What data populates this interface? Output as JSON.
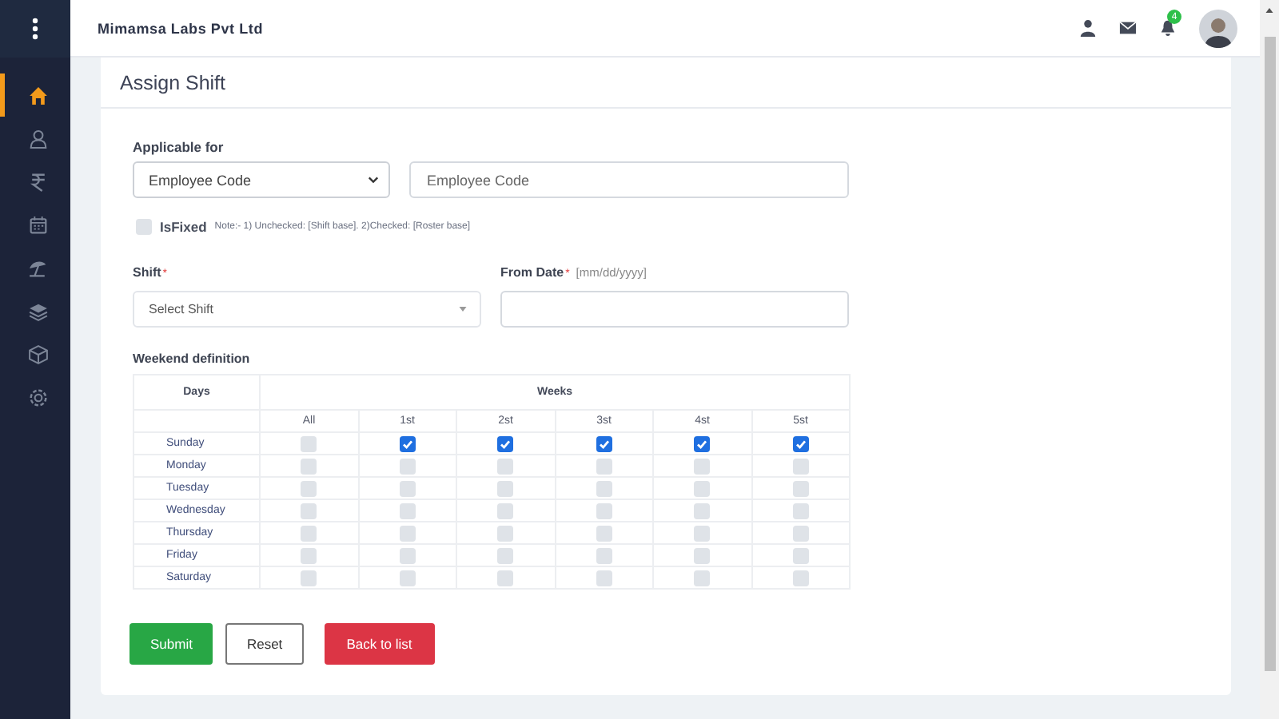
{
  "header": {
    "company": "Mimamsa Labs Pvt Ltd",
    "notification_count": "4"
  },
  "sidebar": {
    "items": [
      {
        "kind": "home",
        "selected": true
      },
      {
        "kind": "users",
        "selected": false
      },
      {
        "kind": "rupee",
        "selected": false
      },
      {
        "kind": "calendar",
        "selected": false
      },
      {
        "kind": "umbrella",
        "selected": false
      },
      {
        "kind": "layers",
        "selected": false
      },
      {
        "kind": "box",
        "selected": false
      },
      {
        "kind": "gear",
        "selected": false
      }
    ]
  },
  "page_title": "Assign Shift",
  "applicable_for": {
    "label": "Applicable for",
    "select_value": "Employee Code",
    "input_placeholder": "Employee Code"
  },
  "is_fixed": {
    "label": "IsFixed",
    "checked": false,
    "note": "Note:- 1) Unchecked: [Shift base]. 2)Checked: [Roster base]"
  },
  "shift": {
    "label": "Shift",
    "required_mark": "*",
    "placeholder": "Select Shift"
  },
  "from_date": {
    "label": "From Date",
    "required_mark": "*",
    "hint": "[mm/dd/yyyy]"
  },
  "weekend": {
    "title": "Weekend definition",
    "days_heading": "Days",
    "weeks_heading": "Weeks",
    "columns": [
      "All",
      "1st",
      "2st",
      "3st",
      "4st",
      "5st"
    ],
    "rows": [
      {
        "day": "Sunday",
        "checks": [
          false,
          true,
          true,
          true,
          true,
          true
        ]
      },
      {
        "day": "Monday",
        "checks": [
          false,
          false,
          false,
          false,
          false,
          false
        ]
      },
      {
        "day": "Tuesday",
        "checks": [
          false,
          false,
          false,
          false,
          false,
          false
        ]
      },
      {
        "day": "Wednesday",
        "checks": [
          false,
          false,
          false,
          false,
          false,
          false
        ]
      },
      {
        "day": "Thursday",
        "checks": [
          false,
          false,
          false,
          false,
          false,
          false
        ]
      },
      {
        "day": "Friday",
        "checks": [
          false,
          false,
          false,
          false,
          false,
          false
        ]
      },
      {
        "day": "Saturday",
        "checks": [
          false,
          false,
          false,
          false,
          false,
          false
        ]
      }
    ]
  },
  "buttons": [
    {
      "label": "Submit",
      "kind": "primary"
    },
    {
      "label": "Reset",
      "kind": "outline"
    },
    {
      "label": "Back to list",
      "kind": "danger"
    }
  ]
}
